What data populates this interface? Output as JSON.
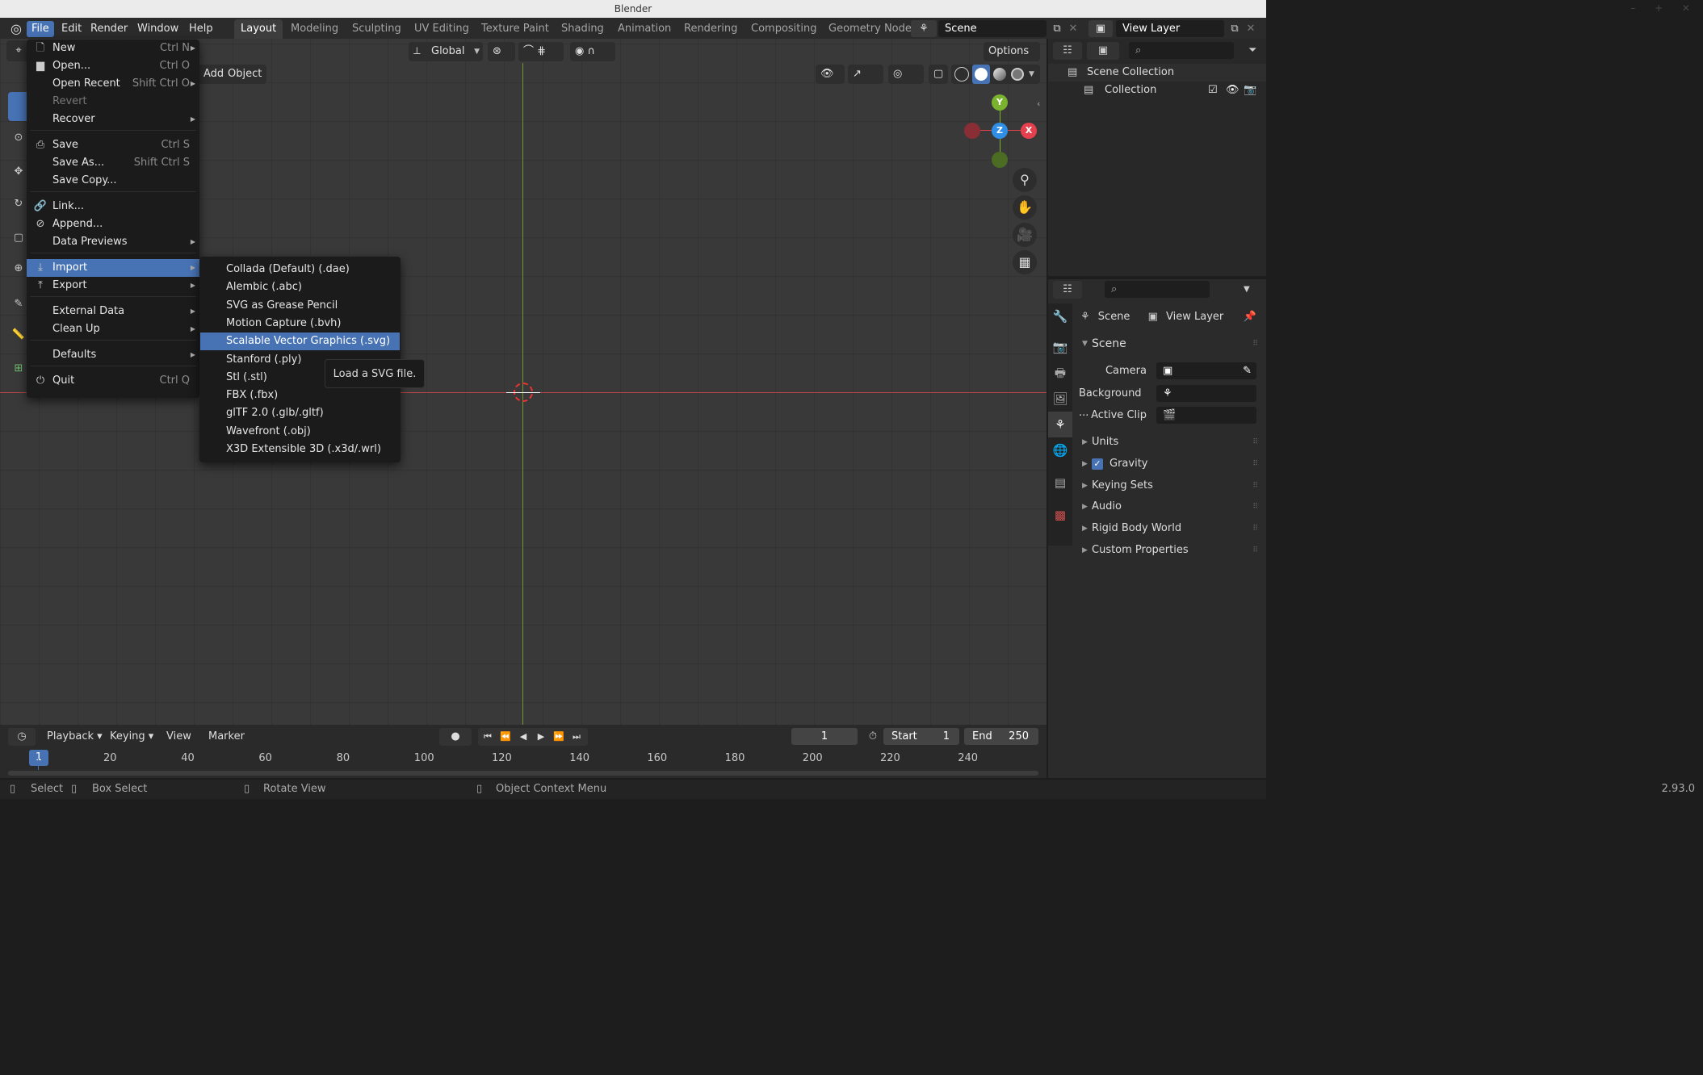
{
  "window": {
    "title": "Blender",
    "controls": "– + ✕"
  },
  "menubar": [
    {
      "label": "File",
      "active": true
    },
    {
      "label": "Edit"
    },
    {
      "label": "Render"
    },
    {
      "label": "Window"
    },
    {
      "label": "Help"
    }
  ],
  "workspaces": [
    "Layout",
    "Modeling",
    "Sculpting",
    "UV Editing",
    "Texture Paint",
    "Shading",
    "Animation",
    "Rendering",
    "Compositing",
    "Geometry Node"
  ],
  "scene_field": "Scene",
  "view_layer_field": "View Layer",
  "viewport": {
    "transform_orientation": "Global",
    "options_label": "Options",
    "header_menus": [
      "Add",
      "Object"
    ],
    "gizmo": {
      "y": "Y",
      "z": "Z",
      "x": "X"
    }
  },
  "file_menu": [
    {
      "icon": "new-file-icon",
      "glyph": "🗋",
      "label": "New",
      "shortcut": "Ctrl N",
      "arrow": true
    },
    {
      "icon": "folder-icon",
      "glyph": "▆",
      "label": "Open...",
      "shortcut": "Ctrl O"
    },
    {
      "icon": "",
      "glyph": "",
      "label": "Open Recent",
      "shortcut": "Shift Ctrl O",
      "arrow": true
    },
    {
      "icon": "",
      "glyph": "",
      "label": "Revert",
      "disabled": true
    },
    {
      "icon": "",
      "glyph": "",
      "label": "Recover",
      "arrow": true
    },
    {
      "icon": "save-icon",
      "glyph": "⎙",
      "label": "Save",
      "shortcut": "Ctrl S"
    },
    {
      "icon": "",
      "glyph": "",
      "label": "Save As...",
      "shortcut": "Shift Ctrl S"
    },
    {
      "icon": "",
      "glyph": "",
      "label": "Save Copy..."
    },
    {
      "icon": "link-icon",
      "glyph": "🔗",
      "label": "Link..."
    },
    {
      "icon": "append-icon",
      "glyph": "⊘",
      "label": "Append..."
    },
    {
      "icon": "",
      "glyph": "",
      "label": "Data Previews",
      "arrow": true
    },
    {
      "icon": "import-icon",
      "glyph": "⤓",
      "label": "Import",
      "arrow": true,
      "highlight": true
    },
    {
      "icon": "export-icon",
      "glyph": "⤒",
      "label": "Export",
      "arrow": true
    },
    {
      "icon": "",
      "glyph": "",
      "label": "External Data",
      "arrow": true
    },
    {
      "icon": "",
      "glyph": "",
      "label": "Clean Up",
      "arrow": true
    },
    {
      "icon": "",
      "glyph": "",
      "label": "Defaults",
      "arrow": true
    },
    {
      "icon": "quit-icon",
      "glyph": "⏻",
      "label": "Quit",
      "shortcut": "Ctrl Q"
    }
  ],
  "import_menu": [
    {
      "label": "Collada (Default) (.dae)"
    },
    {
      "label": "Alembic (.abc)"
    },
    {
      "label": "SVG as Grease Pencil"
    },
    {
      "label": "Motion Capture (.bvh)"
    },
    {
      "label": "Scalable Vector Graphics (.svg)",
      "highlight": true
    },
    {
      "label": "Stanford (.ply)"
    },
    {
      "label": "Stl (.stl)"
    },
    {
      "label": "FBX (.fbx)"
    },
    {
      "label": "glTF 2.0 (.glb/.gltf)"
    },
    {
      "label": "Wavefront (.obj)"
    },
    {
      "label": "X3D Extensible 3D (.x3d/.wrl)"
    }
  ],
  "tooltip": "Load a SVG file.",
  "outliner": {
    "scene_collection": "Scene Collection",
    "collection": "Collection"
  },
  "properties": {
    "header_scene": "Scene",
    "header_view_layer": "View Layer",
    "section_scene": "Scene",
    "camera_label": "Camera",
    "background_label": "Background ...",
    "active_clip_label": "Active Clip",
    "panels": [
      "Units",
      "Gravity",
      "Keying Sets",
      "Audio",
      "Rigid Body World",
      "Custom Properties"
    ]
  },
  "timeline": {
    "menus": [
      "Playback",
      "Keying",
      "View",
      "Marker"
    ],
    "current_frame": "1",
    "start_label": "Start",
    "start_value": "1",
    "end_label": "End",
    "end_value": "250",
    "ruler": [
      "1",
      "20",
      "40",
      "60",
      "80",
      "100",
      "120",
      "140",
      "160",
      "180",
      "200",
      "220",
      "240"
    ]
  },
  "statusbar": {
    "select": "Select",
    "box_select": "Box Select",
    "rotate_view": "Rotate View",
    "context_menu": "Object Context Menu",
    "version": "2.93.0"
  },
  "colors": {
    "accent": "#4772b3",
    "x_axis": "#e5404e",
    "y_axis": "#7ab32e",
    "z_axis": "#2f8ee5"
  }
}
